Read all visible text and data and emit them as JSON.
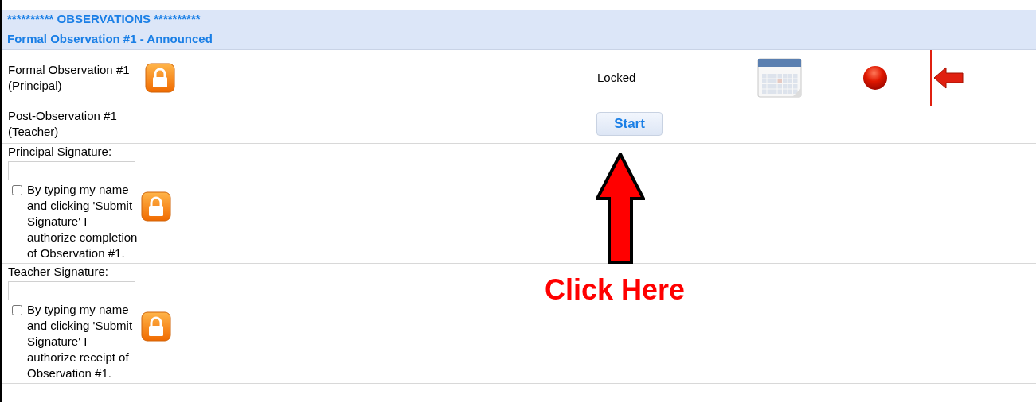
{
  "section_header": "********** OBSERVATIONS **********",
  "subsection_header": "Formal Observation #1 - Announced",
  "rows": [
    {
      "kind": "status",
      "label": "Formal Observation #1 (Principal)",
      "locked": true,
      "status": "Locked",
      "flagged": true
    },
    {
      "kind": "action",
      "label": "Post-Observation #1 (Teacher)",
      "button": "Start"
    },
    {
      "kind": "signature",
      "label": "Principal Signature:",
      "checked": false,
      "text": "By typing my name and clicking 'Submit Signature' I authorize completion of Observation #1.",
      "locked": true
    },
    {
      "kind": "signature",
      "label": "Teacher Signature:",
      "checked": false,
      "text": "By typing my name and clicking 'Submit Signature' I authorize receipt of Observation #1.",
      "locked": true
    }
  ],
  "annotation": {
    "text": "Click Here"
  }
}
